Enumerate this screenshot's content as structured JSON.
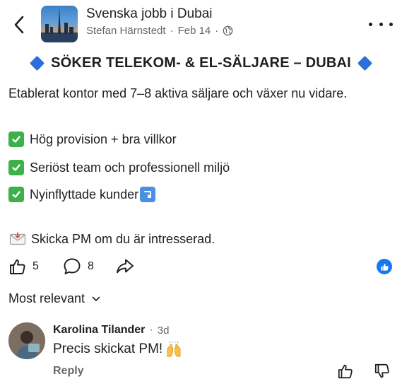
{
  "header": {
    "group_name": "Svenska jobb i Dubai",
    "author": "Stefan Härnstedt",
    "separator": "·",
    "date": "Feb 14",
    "icons": {
      "back": "chevron-left-icon",
      "more": "more-dots-icon",
      "audience": "globe-icon"
    }
  },
  "post": {
    "headline": "SÖKER TELEKOM- & EL-SÄLJARE – DUBAI",
    "intro": "Etablerat kontor med 7–8 aktiva säljare och växer nu vidare.",
    "bullets": [
      {
        "text": "Hög provision + bra villkor",
        "icon": "check-mark-icon"
      },
      {
        "text": "Seriöst team och professionell miljö",
        "icon": "check-mark-icon"
      },
      {
        "text": "Nyinflyttade kunder",
        "icon": "check-mark-icon",
        "trailing_icon": "arrow-down-right-icon"
      }
    ],
    "cta": "Skicka PM om du är intresserad.",
    "cta_icon": "envelope-icon"
  },
  "actions": {
    "likes": "5",
    "comments": "8",
    "icons": {
      "like": "thumbs-up-icon",
      "comment": "comment-bubble-icon",
      "share": "share-arrow-icon",
      "reaction": "like-reaction-icon"
    }
  },
  "comments_sort": {
    "label": "Most relevant"
  },
  "comment": {
    "author": "Karolina Tilander",
    "separator": "·",
    "time": "3d",
    "text": "Precis skickat PM!",
    "reply_label": "Reply"
  },
  "colors": {
    "accent_blue": "#1877f2",
    "diamond_blue": "#2d6fd8",
    "check_green": "#3db04a",
    "secondary_text": "#65676b"
  }
}
